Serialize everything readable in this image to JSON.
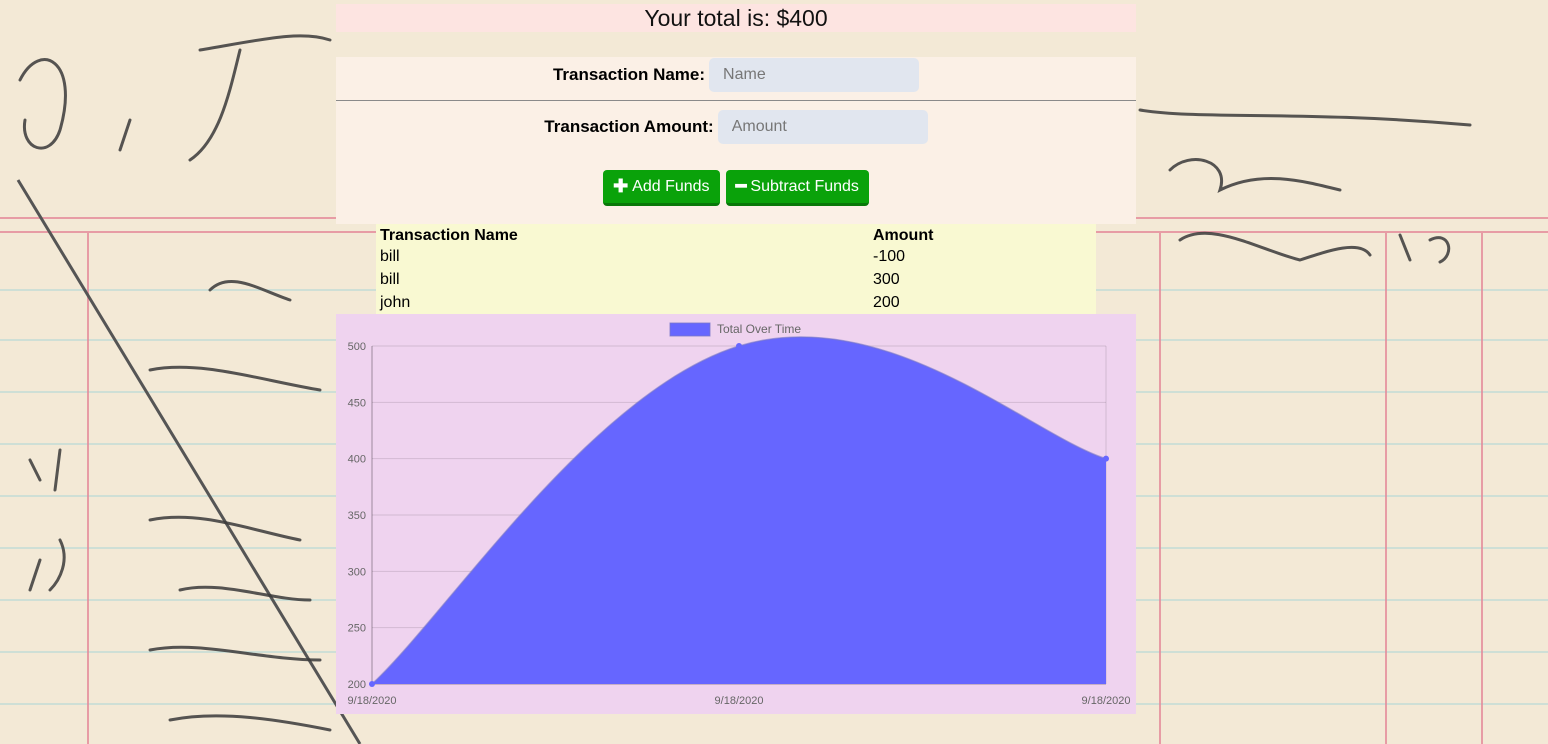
{
  "total": {
    "label": "Your total is: $400"
  },
  "form": {
    "name_label": "Transaction Name:",
    "name_placeholder": "Name",
    "amount_label": "Transaction Amount:",
    "amount_placeholder": "Amount",
    "add_label": "Add Funds",
    "subtract_label": "Subtract Funds"
  },
  "table": {
    "headers": [
      "Transaction Name",
      "Amount"
    ],
    "rows": [
      [
        "bill",
        "-100"
      ],
      [
        "bill",
        "300"
      ],
      [
        "john",
        "200"
      ]
    ]
  },
  "icons": {
    "add": "plus-icon",
    "subtract": "minus-icon"
  },
  "colors": {
    "button": "#0aa20a",
    "area_fill": "#6666ff",
    "chart_bg": "#efd3ef",
    "table_bg": "#f9f9d2",
    "banner_bg": "#fde4e1"
  },
  "chart_data": {
    "type": "area",
    "categories": [
      "9/18/2020",
      "9/18/2020",
      "9/18/2020"
    ],
    "series": [
      {
        "name": "Total Over Time",
        "values": [
          200,
          500,
          400
        ]
      }
    ],
    "ylim": [
      200,
      500
    ],
    "yticks": [
      200,
      250,
      300,
      350,
      400,
      450,
      500
    ],
    "grid": true,
    "legend": "top-center"
  }
}
